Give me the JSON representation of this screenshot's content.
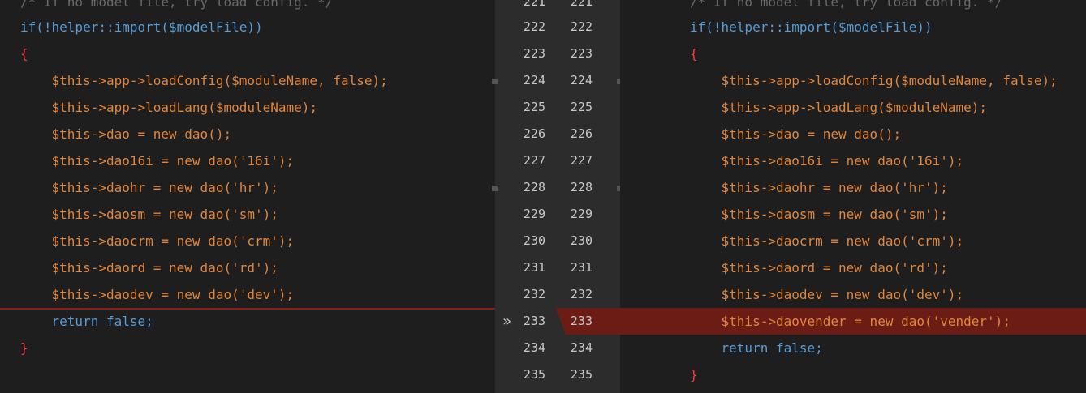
{
  "diff": {
    "left": {
      "line_numbers": [
        "221",
        "222",
        "223",
        "224",
        "225",
        "226",
        "227",
        "228",
        "229",
        "230",
        "231",
        "232",
        "233",
        "234",
        "235"
      ],
      "lines": {
        "l221": "/* If no model file, try load config. */",
        "l222": "if(!helper::import($modelFile))",
        "l223": "{",
        "l224": "    $this->app->loadConfig($moduleName, false);",
        "l225": "    $this->app->loadLang($moduleName);",
        "l226": "    $this->dao = new dao();",
        "l227": "    $this->dao16i = new dao('16i');",
        "l228": "    $this->daohr = new dao('hr');",
        "l229": "    $this->daosm = new dao('sm');",
        "l230": "    $this->daocrm = new dao('crm');",
        "l231": "    $this->daord = new dao('rd');",
        "l232": "    $this->daodev = new dao('dev');",
        "l233": "    return false;",
        "l234": "}"
      }
    },
    "right": {
      "line_numbers": [
        "221",
        "222",
        "223",
        "224",
        "225",
        "226",
        "227",
        "228",
        "229",
        "230",
        "231",
        "232",
        "233",
        "234",
        "235"
      ],
      "lines": {
        "r221": "/* If no model file, try load config. */",
        "r222": "if(!helper::import($modelFile))",
        "r223": "{",
        "r224": "    $this->app->loadConfig($moduleName, false);",
        "r225": "    $this->app->loadLang($moduleName);",
        "r226": "    $this->dao = new dao();",
        "r227": "    $this->dao16i = new dao('16i');",
        "r228": "    $this->daohr = new dao('hr');",
        "r229": "    $this->daosm = new dao('sm');",
        "r230": "    $this->daocrm = new dao('crm');",
        "r231": "    $this->daord = new dao('rd');",
        "r232": "    $this->daodev = new dao('dev');",
        "r233": "    $this->daovender = new dao('vender');",
        "r234": "    return false;",
        "r235": "}"
      }
    },
    "revert_icon": "»",
    "colors": {
      "background": "#1e1e1e",
      "gutter": "#2c2c2c",
      "inserted_line": "#6b1d15",
      "keyword": "#569cd6",
      "variable": "#e0853a",
      "string": "#ffd000",
      "brace": "#ff3b3b"
    }
  }
}
